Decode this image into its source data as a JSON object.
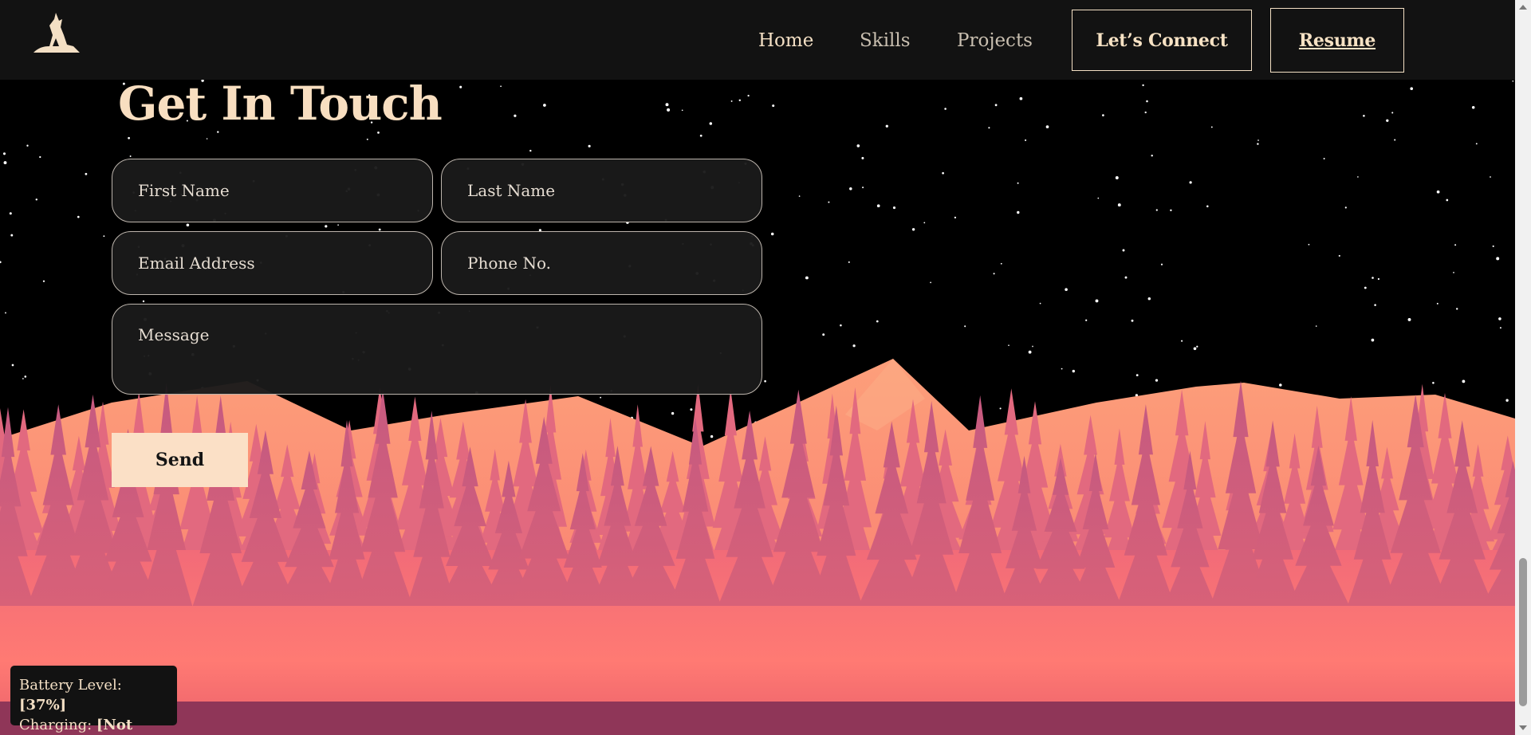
{
  "nav": {
    "links": [
      {
        "label": "Home",
        "active": true
      },
      {
        "label": "Skills",
        "active": false
      },
      {
        "label": "Projects",
        "active": false
      }
    ],
    "connect_label": "Let’s Connect",
    "resume_label": "Resume"
  },
  "contact": {
    "heading": "Get In Touch",
    "first_name_placeholder": "First Name",
    "last_name_placeholder": "Last Name",
    "email_placeholder": "Email Address",
    "phone_placeholder": "Phone No.",
    "message_placeholder": "Message",
    "send_label": "Send"
  },
  "battery": {
    "level_label": "Battery Level:",
    "level_value": "[37%]",
    "charging_label": "Charging:",
    "charging_value": "[Not Active]"
  },
  "icons": {
    "logo": "wolf-howling-icon"
  },
  "colors": {
    "header_bg": "#121212",
    "accent_cream": "#f3dfc4",
    "field_bg": "#1a1a1a",
    "sky": "#000000",
    "mountain": "#fb8f76",
    "trees": "#c9577c"
  }
}
